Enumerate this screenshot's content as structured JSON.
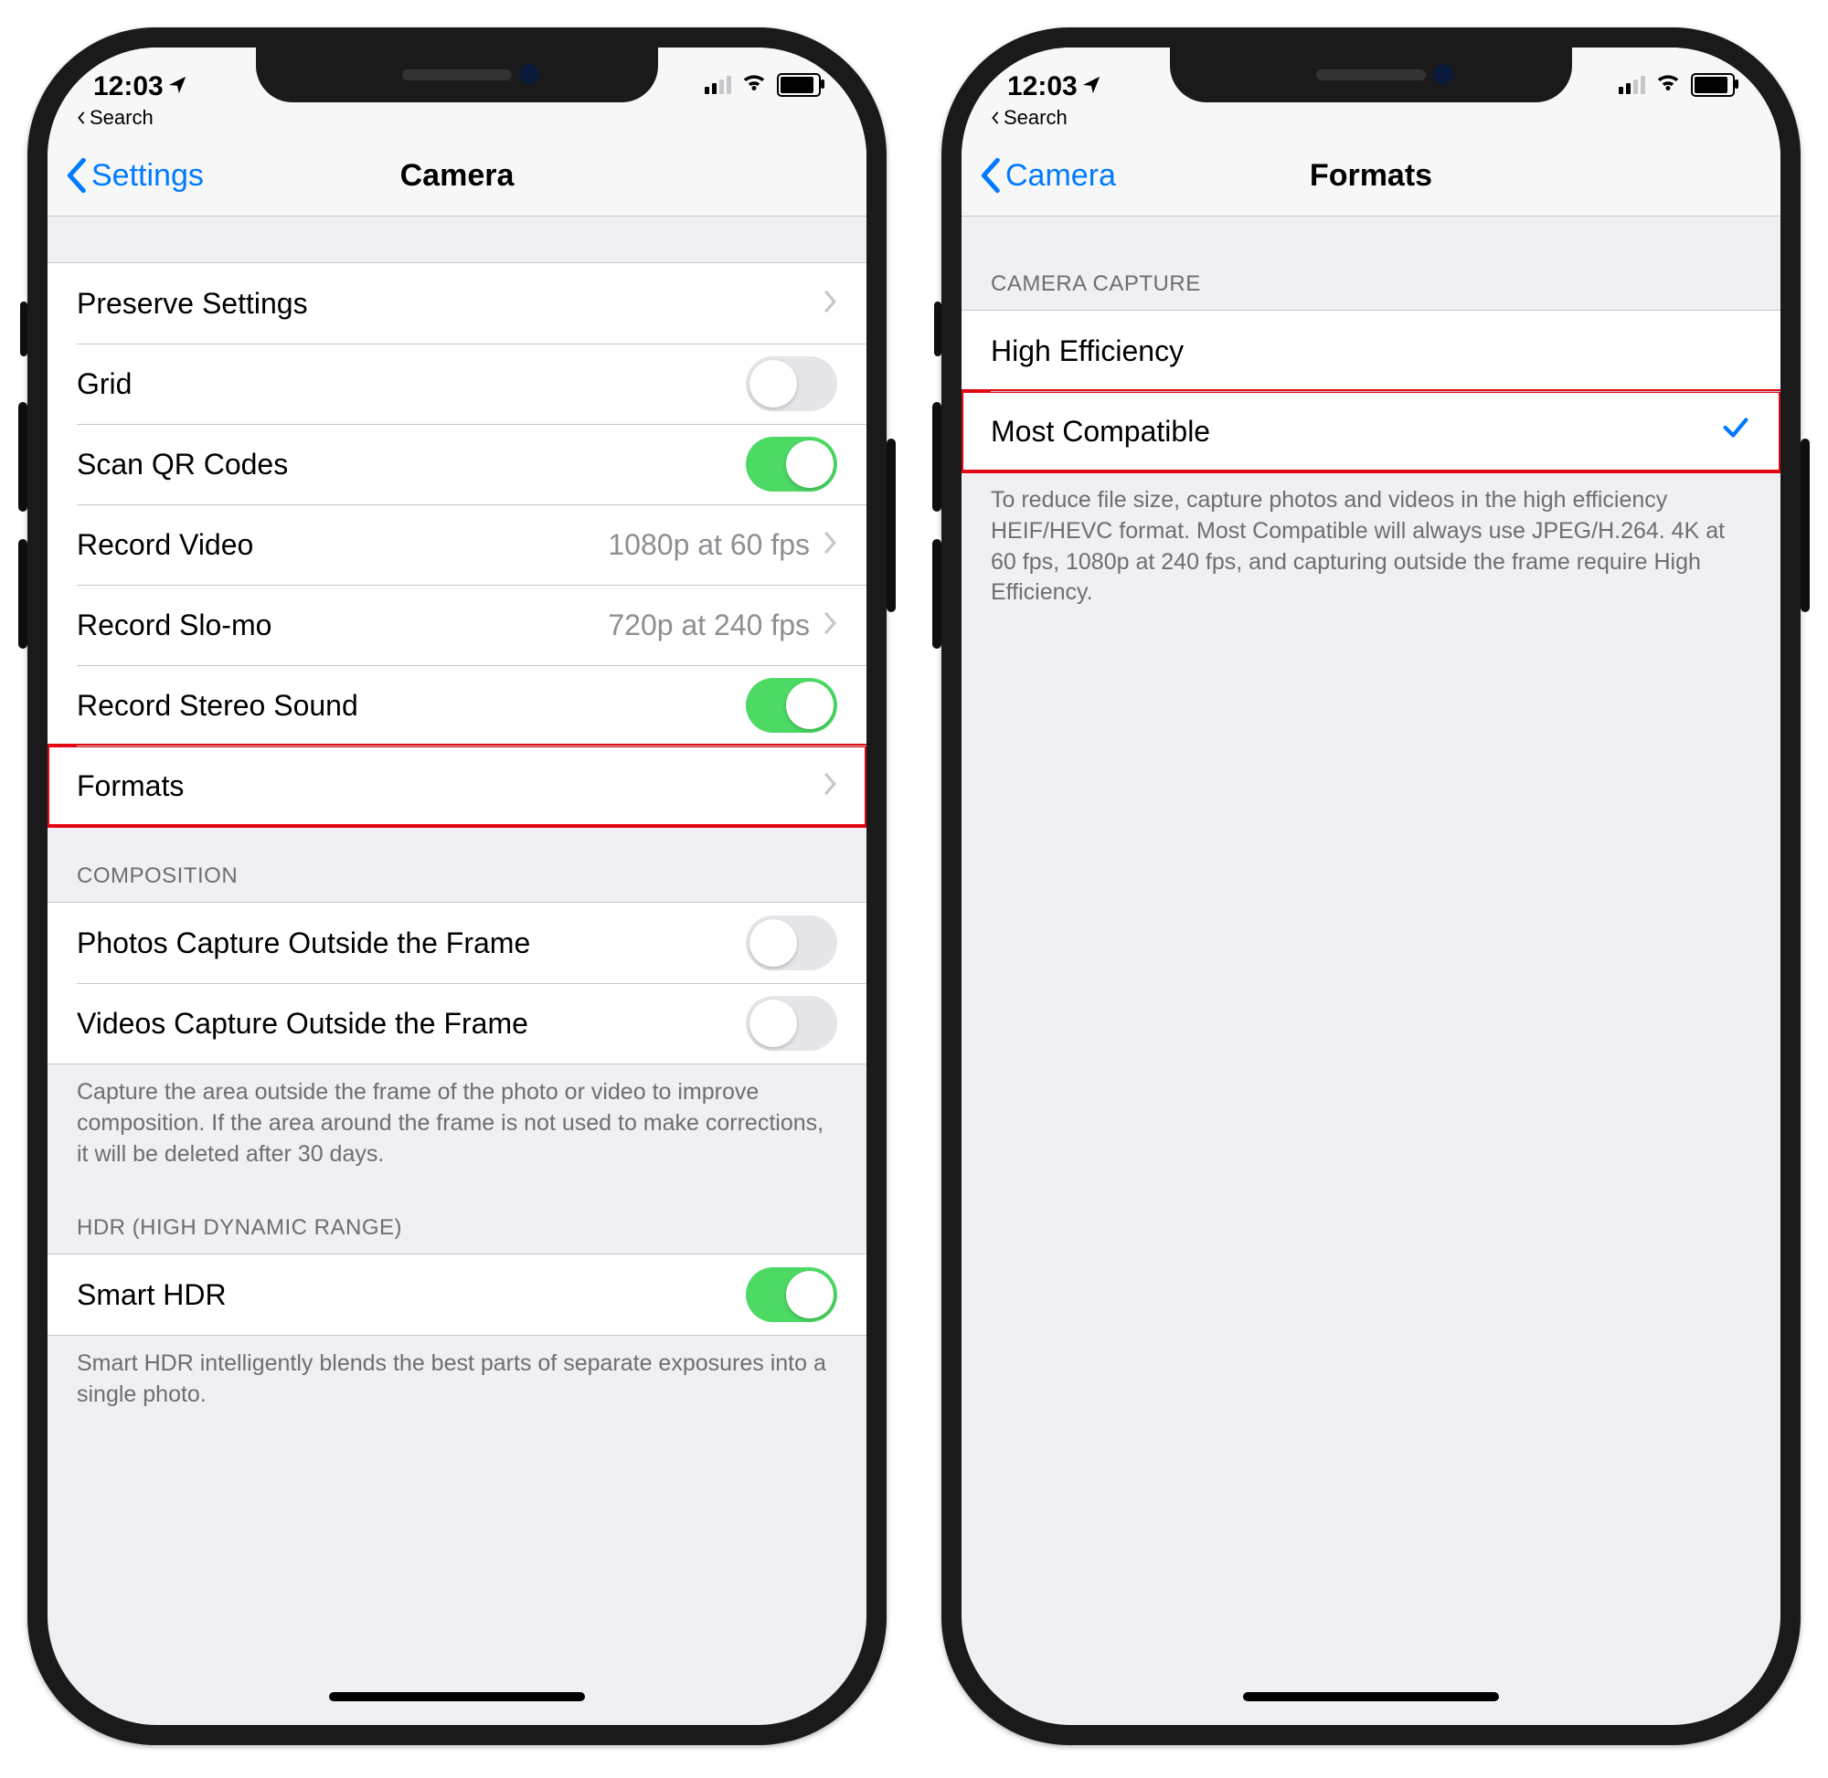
{
  "status": {
    "time": "12:03",
    "breadcrumb": "Search"
  },
  "left": {
    "back": "Settings",
    "title": "Camera",
    "rows": {
      "preserve": "Preserve Settings",
      "grid": "Grid",
      "scanqr": "Scan QR Codes",
      "recvideo_label": "Record Video",
      "recvideo_detail": "1080p at 60 fps",
      "slomo_label": "Record Slo-mo",
      "slomo_detail": "720p at 240 fps",
      "stereo": "Record Stereo Sound",
      "formats": "Formats"
    },
    "composition_header": "Composition",
    "comp_photos": "Photos Capture Outside the Frame",
    "comp_videos": "Videos Capture Outside the Frame",
    "comp_footer": "Capture the area outside the frame of the photo or video to improve composition. If the area around the frame is not used to make corrections, it will be deleted after 30 days.",
    "hdr_header": "HDR (High Dynamic Range)",
    "hdr_row": "Smart HDR",
    "hdr_footer": "Smart HDR intelligently blends the best parts of separate exposures into a single photo."
  },
  "right": {
    "back": "Camera",
    "title": "Formats",
    "capture_header": "Camera Capture",
    "high_eff": "High Efficiency",
    "most_compat": "Most Compatible",
    "footer": "To reduce file size, capture photos and videos in the high efficiency HEIF/HEVC format. Most Compatible will always use JPEG/H.264. 4K at 60 fps, 1080p at 240 fps, and capturing outside the frame require High Efficiency."
  }
}
